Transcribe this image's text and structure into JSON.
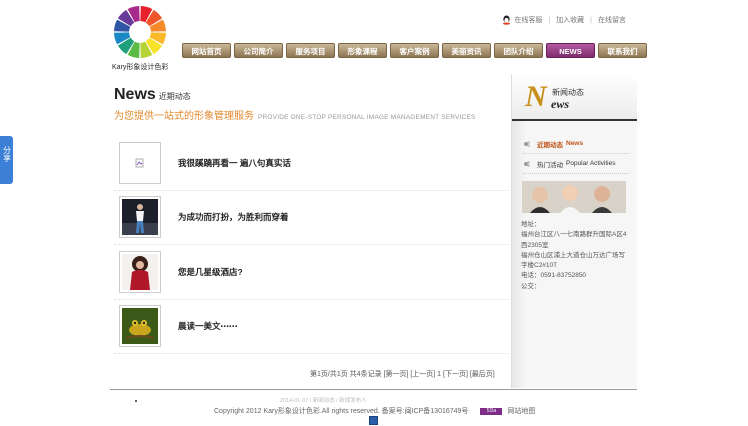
{
  "share_tab": {
    "label": "分享"
  },
  "logo": {
    "text": "Kary形象设计色彩"
  },
  "top_links": [
    {
      "label": "在线客服"
    },
    {
      "label": "加入收藏"
    },
    {
      "label": "在线留言"
    }
  ],
  "top_sep": "|",
  "nav": [
    {
      "label": "网站首页",
      "active": false
    },
    {
      "label": "公司简介",
      "active": false
    },
    {
      "label": "服务项目",
      "active": false
    },
    {
      "label": "形象课程",
      "active": false
    },
    {
      "label": "客户案例",
      "active": false
    },
    {
      "label": "美丽资讯",
      "active": false
    },
    {
      "label": "团队介绍",
      "active": false
    },
    {
      "label": "NEWS",
      "active": true
    },
    {
      "label": "联系我们",
      "active": false
    }
  ],
  "main": {
    "title": "News",
    "title_sub": "近期动态",
    "tagline_cn": "为您提供一站式的形象管理服务",
    "tagline_en": "PROVIDE ONE-STOP PERSONAL IMAGE MANAGEMENT SERVICES",
    "items": [
      {
        "title": "我很蹊蹺再看一  遍八句真实话",
        "thumb": "broken-image-icon"
      },
      {
        "title": "为成功而打扮，为胜利而穿着",
        "thumb": "fashion-model-photo"
      },
      {
        "title": "您是几星级酒店?",
        "thumb": "woman-portrait-photo"
      },
      {
        "title": "晨读一美文⋯⋯",
        "thumb": "frog-photo"
      }
    ],
    "pager": "第1页/共1页     共4条记录 [第一页] [上一页] 1 [下一页] [最后页]"
  },
  "sidebar": {
    "big_letter": "N",
    "head_cn": "新闻动态",
    "head_en": "ews",
    "menu": [
      {
        "label": "近期动态",
        "en": "News",
        "active": true
      },
      {
        "label": "热门活动",
        "en": "Popular Activities",
        "active": false
      }
    ],
    "contact_lines": [
      "地址：",
      "福州台江区八一七南路群升国际A区4",
      "西2305室",
      "福州仓山区浦上大道仓山万达广场写",
      "字楼C2#10T",
      "电话：0591-83752850",
      "公交："
    ]
  },
  "footer": {
    "stamp": "2014-01-07 / 新闻动态 / 新闻发布人",
    "copyright": "Copyright 2012 Kary形象设计色彩.All rights reserved. 备案号:闽ICP备13016749号",
    "badge": "51la",
    "sitemap": "网站地图"
  },
  "colors": {
    "nav": "#a8906b",
    "nav_active": "#9a3f88",
    "accent_orange": "#e2892d",
    "sidebar_gold": "#c8901a"
  }
}
